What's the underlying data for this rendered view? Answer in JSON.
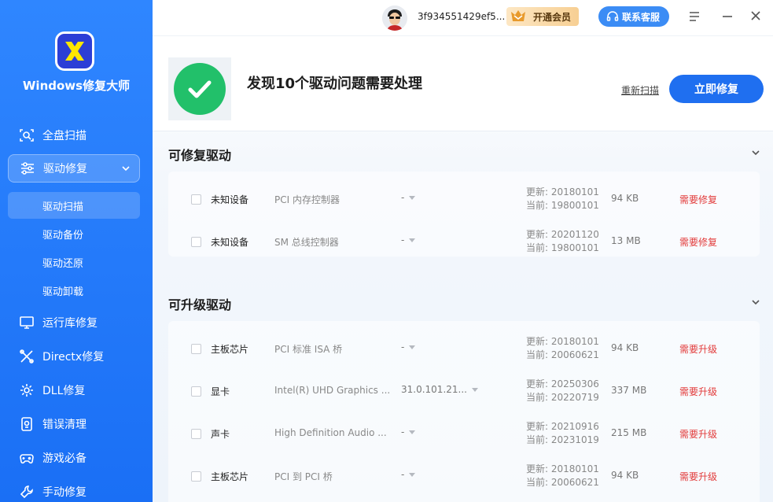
{
  "app": {
    "name": "Windows修复大师"
  },
  "sidebar": {
    "items": [
      {
        "label": "全盘扫描",
        "icon": "scan-icon"
      },
      {
        "label": "驱动修复",
        "icon": "sliders-icon"
      },
      {
        "label": "运行库修复",
        "icon": "monitor-icon"
      },
      {
        "label": "Directx修复",
        "icon": "wrench-cross-icon"
      },
      {
        "label": "DLL修复",
        "icon": "gear-icon"
      },
      {
        "label": "错误清理",
        "icon": "clean-icon"
      },
      {
        "label": "游戏必备",
        "icon": "gamepad-icon"
      },
      {
        "label": "手动修复",
        "icon": "manual-wrench-icon"
      }
    ],
    "sub_items": [
      {
        "label": "驱动扫描"
      },
      {
        "label": "驱动备份"
      },
      {
        "label": "驱动还原"
      },
      {
        "label": "驱动卸载"
      }
    ]
  },
  "topbar": {
    "username": "3f934551429ef5...",
    "vip_label": "开通会员",
    "support_label": "联系客服"
  },
  "header": {
    "headline": "发现10个驱动问题需要处理",
    "rescan_label": "重新扫描",
    "fix_label": "立即修复"
  },
  "sections": {
    "fixable": {
      "title": "可修复驱动",
      "rows": [
        {
          "name": "未知设备",
          "desc": "PCI 内存控制器",
          "version": "-",
          "latest": "更新: 20180101",
          "current": "当前: 19800101",
          "size": "94 KB",
          "status": "需要修复"
        },
        {
          "name": "未知设备",
          "desc": "SM 总线控制器",
          "version": "-",
          "latest": "更新: 20201120",
          "current": "当前: 19800101",
          "size": "13 MB",
          "status": "需要修复"
        }
      ]
    },
    "upgradable": {
      "title": "可升级驱动",
      "rows": [
        {
          "name": "主板芯片",
          "desc": "PCI 标准 ISA 桥",
          "version": "-",
          "latest": "更新: 20180101",
          "current": "当前: 20060621",
          "size": "94 KB",
          "status": "需要升级"
        },
        {
          "name": "显卡",
          "desc": "Intel(R) UHD Graphics ...",
          "version": "31.0.101.21...",
          "latest": "更新: 20250306",
          "current": "当前: 20220719",
          "size": "337 MB",
          "status": "需要升级"
        },
        {
          "name": "声卡",
          "desc": "High Definition Audio ...",
          "version": "-",
          "latest": "更新: 20210916",
          "current": "当前: 20231019",
          "size": "215 MB",
          "status": "需要升级"
        },
        {
          "name": "主板芯片",
          "desc": "PCI 到 PCI 桥",
          "version": "-",
          "latest": "更新: 20180101",
          "current": "当前: 20060621",
          "size": "94 KB",
          "status": "需要升级"
        }
      ]
    }
  },
  "colors": {
    "accent": "#1f6ff0",
    "sidebar": "#2f86ff",
    "success": "#22c06a",
    "warning_text": "#e23b3b"
  }
}
